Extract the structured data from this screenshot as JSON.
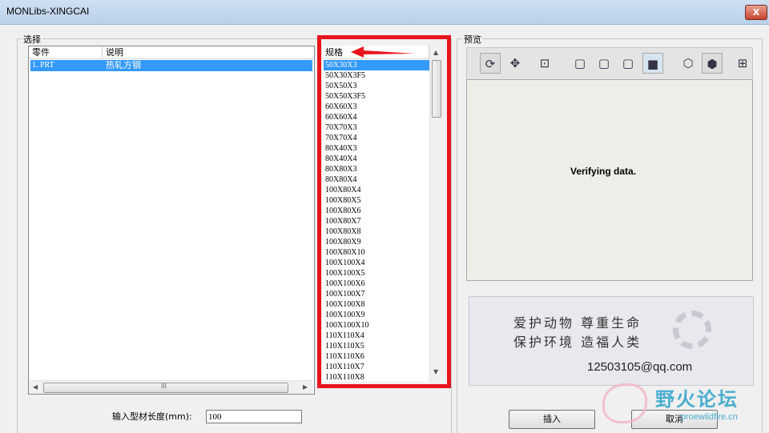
{
  "window": {
    "title": "MONLibs-XINGCAI",
    "close_label": "X"
  },
  "select_group": {
    "label": "选择",
    "columns": [
      "零件",
      "说明"
    ],
    "rows": [
      {
        "part": "1. PRT",
        "desc": "热轧方钢"
      }
    ],
    "hscroll_glyph": "III"
  },
  "spec_list": {
    "header": "规格",
    "items": [
      "50X30X3",
      "50X30X3F5",
      "50X50X3",
      "50X50X3F5",
      "60X60X3",
      "60X60X4",
      "70X70X3",
      "70X70X4",
      "80X40X3",
      "80X40X4",
      "80X80X3",
      "80X80X4",
      "100X80X4",
      "100X80X5",
      "100X80X6",
      "100X80X7",
      "100X80X8",
      "100X80X9",
      "100X80X10",
      "100X100X4",
      "100X100X5",
      "100X100X6",
      "100X100X7",
      "100X100X8",
      "100X100X9",
      "100X100X10",
      "110X110X4",
      "110X110X5",
      "110X110X6",
      "110X110X7",
      "110X110X8"
    ],
    "selected_index": 0,
    "highlight_color": "#e8141c"
  },
  "preview_group": {
    "label": "预览",
    "status": "Verifying data.",
    "toolbar_icons": [
      "rotate-view-icon",
      "pan-view-icon",
      "zoom-fit-icon",
      "cube-front-icon",
      "cube-top-icon",
      "cube-right-icon",
      "cube-shaded-icon",
      "cube-wireframe-icon",
      "cube-iso-icon",
      "section-view-icon"
    ]
  },
  "banner": {
    "line1": "爱护动物  尊重生命",
    "line2": "保护环境  造福人类",
    "email": "12503105@qq.com"
  },
  "length_field": {
    "label": "输入型材长度(mm):",
    "value": "100"
  },
  "buttons": {
    "insert": "插入",
    "cancel": "取消"
  },
  "watermark": {
    "text": "野火论坛",
    "url": "proewildfire.cn"
  }
}
